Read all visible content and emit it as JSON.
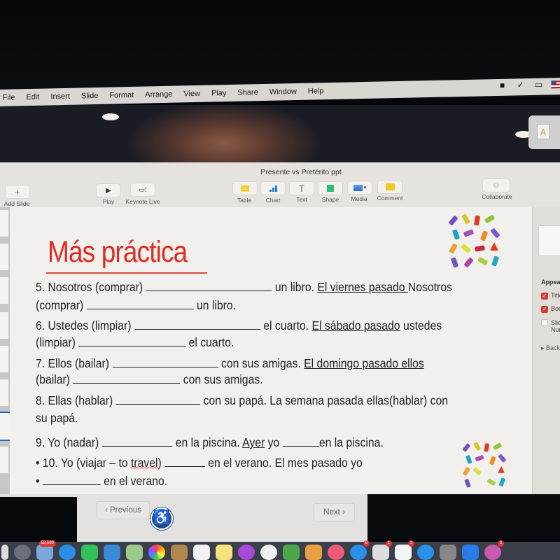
{
  "menubar": {
    "items": [
      "File",
      "Edit",
      "Insert",
      "Slide",
      "Format",
      "Arrange",
      "View",
      "Play",
      "Share",
      "Window",
      "Help"
    ],
    "status_icons": [
      "zoom-icon",
      "checklist-icon",
      "airplay-icon",
      "us-flag-icon"
    ]
  },
  "window": {
    "title": "Presente vs Pretérito ppt"
  },
  "toolbar": {
    "add_slide": "Add Slide",
    "play": "Play",
    "keynote_live": "Keynote Live",
    "table": "Table",
    "chart": "Chart",
    "text": "Text",
    "text_glyph": "T",
    "shape": "Shape",
    "media": "Media",
    "comment": "Comment",
    "collaborate": "Collaborate"
  },
  "slide": {
    "title": "Más práctica",
    "questions": [
      {
        "id": 5,
        "line1_a": "5.  Nosotros (comprar) ",
        "line1_b": " un libro.  ",
        "line1_u": "El viernes pasado ",
        "line1_c": "Nosotros",
        "line2_a": "(comprar) ",
        "line2_b": " un libro."
      },
      {
        "id": 6,
        "line1_a": "6.  Ustedes (limpiar) ",
        "line1_b": " el cuarto.  ",
        "line1_u": "El sábado pasado",
        "line1_c": " ustedes",
        "line2_a": "(limpiar) ",
        "line2_b": " el cuarto."
      },
      {
        "id": 7,
        "line1_a": "7.  Ellos (bailar) ",
        "line1_b": " con sus amigas.  ",
        "line1_u": "El domingo pasado ellos",
        "line1_c": "",
        "line2_a": "(bailar) ",
        "line2_b": " con sus amigas."
      },
      {
        "id": 8,
        "line1_a": "8.  Ellas (hablar) ",
        "line1_b": " con su papá.  La semana pasada ellas(hablar)  con",
        "line1_u": "",
        "line1_c": "",
        "line2_a": "su papá.",
        "line2_b": ""
      },
      {
        "id": 9,
        "line1_a": "9. Yo (nadar) ",
        "line1_b": " en la piscina.  ",
        "line1_u": "Ayer",
        "line1_c": "  yo ",
        "line1_d": "en la piscina."
      },
      {
        "id": 10,
        "line1_a": "• 10.  Yo (viajar – to ",
        "line1_u": "travel",
        "line1_c": ") ",
        "line1_b": " en el verano.  El mes pasado yo",
        "line2_a": "•  ",
        "line2_b": " en el verano."
      }
    ]
  },
  "inspector": {
    "appearance": "Appearance",
    "title_option": "Title",
    "body_option": "Body",
    "slide_number_option": "Slide Number",
    "title_checked": true,
    "body_checked": true,
    "slide_number_checked": false,
    "background": "Background"
  },
  "webpage": {
    "previous": "‹ Previous",
    "next": "Next ›",
    "accessibility_icon": "♿"
  },
  "dock": {
    "mail_badge": "52,589",
    "badges": [
      "6",
      "1",
      "1",
      "3"
    ]
  }
}
